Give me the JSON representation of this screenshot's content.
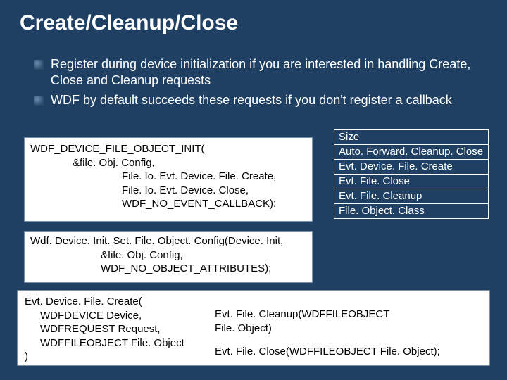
{
  "title": "Create/Cleanup/Close",
  "bullets": [
    "Register during device initialization if you are interested in handling Create, Close and Cleanup requests",
    "WDF by default succeeds these requests if you don't register a callback"
  ],
  "code1": {
    "l1": "WDF_DEVICE_FILE_OBJECT_INIT(",
    "l2": "&file. Obj. Config,",
    "l3": "File. Io. Evt. Device. File. Create,",
    "l4": "File. Io. Evt. Device. Close,",
    "l5": "WDF_NO_EVENT_CALLBACK);"
  },
  "code2": {
    "l1": "Wdf. Device. Init. Set. File. Object. Config(Device. Init,",
    "l2": "&file. Obj. Config,",
    "l3": "WDF_NO_OBJECT_ATTRIBUTES);"
  },
  "code3": {
    "left": {
      "l1": "Evt. Device. File. Create(",
      "l2": "WDFDEVICE Device,",
      "l3": "WDFREQUEST Request,",
      "l4": "WDFFILEOBJECT File. Object",
      "l5": ")"
    },
    "right": {
      "l1": "Evt. File. Cleanup(WDFFILEOBJECT",
      "l2": "File. Object)",
      "l3": "Evt. File. Close(WDFFILEOBJECT File. Object);"
    }
  },
  "sidetable": [
    "Size",
    "Auto. Forward. Cleanup. Close",
    "Evt. Device. File. Create",
    "Evt. File. Close",
    "Evt. File. Cleanup",
    "File. Object. Class"
  ]
}
